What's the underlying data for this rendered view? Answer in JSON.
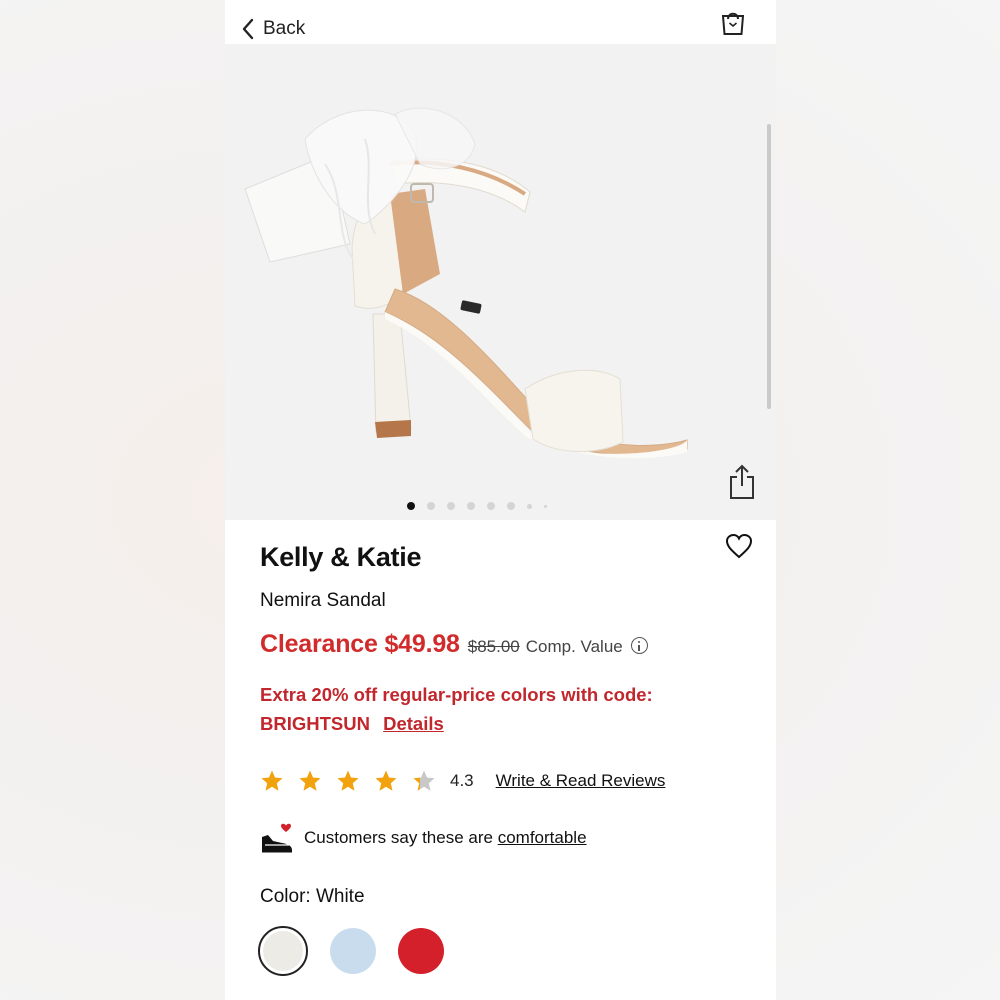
{
  "header": {
    "back_label": "Back",
    "back_icon": "chevron-left-icon",
    "bag_icon": "shopping-bag-icon"
  },
  "gallery": {
    "image_alt": "White satin sandal with tulle bow",
    "dots_count": 8,
    "active_index": 0
  },
  "product": {
    "brand": "Kelly & Katie",
    "name": "Nemira Sandal",
    "price_label": "Clearance $49.98",
    "original_price": "$85.00",
    "comp_label": "Comp. Value",
    "promo_text": "Extra 20% off regular-price colors with code: BRIGHTSUN",
    "promo_details": "Details",
    "rating": "4.3",
    "rating_fraction": 0.86,
    "reviews_link": "Write & Read Reviews",
    "comfort_text": "Customers say these are",
    "comfort_link": "comfortable",
    "color_label": "Color: White"
  },
  "swatches": [
    {
      "name": "White",
      "color": "#ecebe6",
      "selected": true
    },
    {
      "name": "Blue",
      "color": "#c9dcee",
      "selected": false
    },
    {
      "name": "Red",
      "color": "#d3202a",
      "selected": false
    }
  ],
  "colors": {
    "accent_red": "#d12b2b",
    "star": "#f2a20c",
    "star_empty": "#c8c8c8"
  }
}
